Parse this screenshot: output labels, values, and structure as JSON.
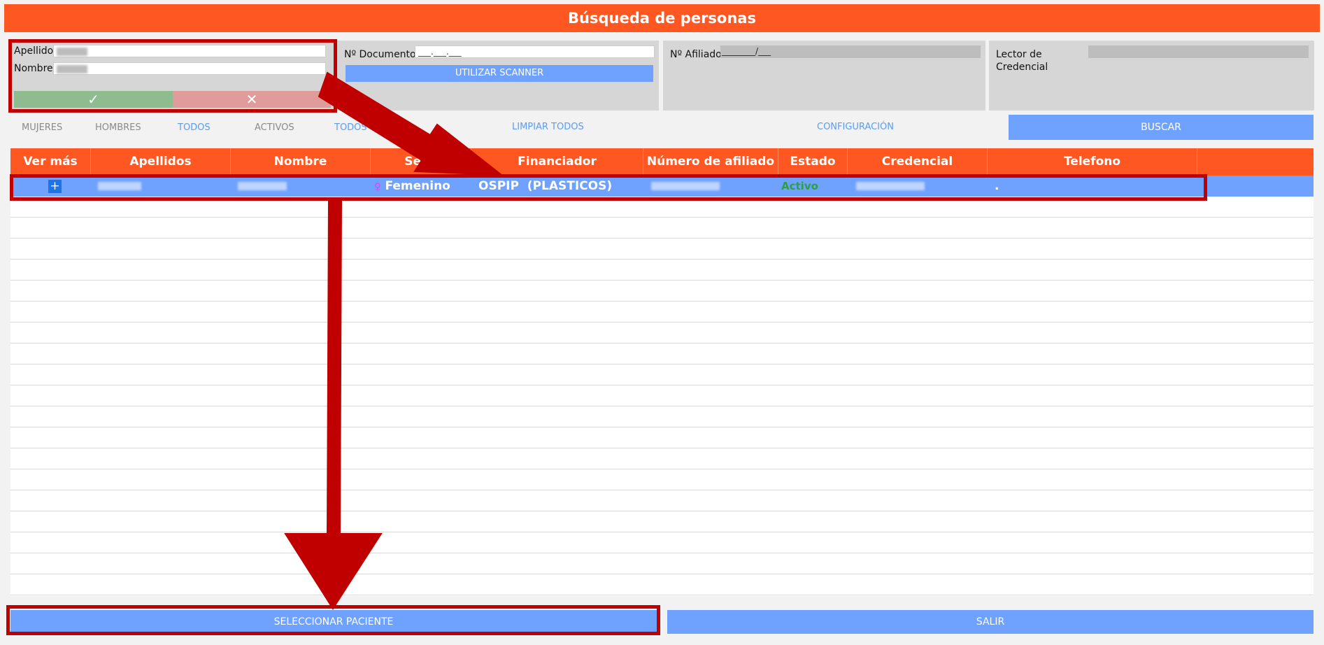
{
  "window": {
    "title": "Búsqueda de personas"
  },
  "search_name": {
    "apellido_label": "Apellido",
    "nombre_label": "Nombre",
    "ok_icon": "check-icon",
    "cancel_icon": "close-icon"
  },
  "search_document": {
    "label": "Nº Documento",
    "value": "___.___.___",
    "scanner_label": "UTILIZAR SCANNER"
  },
  "search_affiliate": {
    "label": "Nº Afiliado",
    "value": "________/___"
  },
  "search_credential": {
    "label_line1": "Lector de",
    "label_line2": "Credencial"
  },
  "filters": {
    "mujeres": "MUJERES",
    "hombres": "HOMBRES",
    "todos_sexo": "TODOS",
    "activos": "ACTIVOS",
    "todos_estado": "TODOS",
    "limpiar": "LIMPIAR TODOS",
    "configuracion": "CONFIGURACIÓN",
    "buscar": "BUSCAR"
  },
  "table": {
    "columns": [
      "Ver más",
      "Apellidos",
      "Nombre",
      "Sexo",
      "Financiador",
      "Número de afiliado",
      "Estado",
      "Credencial",
      "Telefono"
    ],
    "rows": [
      {
        "ver_mas_icon": "plus-icon",
        "sexo_icon": "female-icon",
        "sexo": "Femenino",
        "financiador": "OSPIP  (PLASTICOS)",
        "estado": "Activo",
        "telefono": "."
      }
    ]
  },
  "footer": {
    "select_label": "SELECCIONAR PACIENTE",
    "exit_label": "SALIR"
  },
  "colors": {
    "header": "#ff5722",
    "accent_blue": "#6fa1ff",
    "annotation_red": "#c00000",
    "ok_green": "#8fbc8f",
    "cancel_red": "#e09b9b"
  }
}
